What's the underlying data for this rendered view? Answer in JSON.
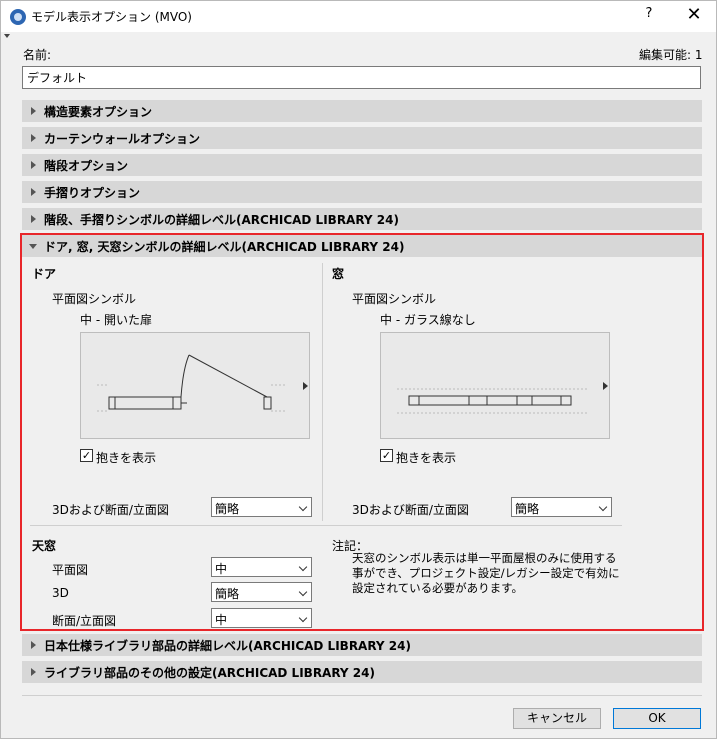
{
  "window": {
    "title": "モデル表示オプション (MVO)",
    "help": "?",
    "close": "✕"
  },
  "name_label": "名前:",
  "edit_label": "編集可能: 1",
  "name_value": "デフォルト",
  "sections_collapsed_top": [
    "構造要素オプション",
    "カーテンウォールオプション",
    "階段オプション",
    "手摺りオプション",
    "階段、手摺りシンボルの詳細レベル(ARCHICAD LIBRARY 24)"
  ],
  "expanded_section": {
    "title": "ドア, 窓, 天窓シンボルの詳細レベル(ARCHICAD LIBRARY 24)",
    "door": {
      "heading": "ドア",
      "plan_symbol_label": "平面図シンボル",
      "plan_symbol_value": "中 - 開いた扉",
      "show_swing_label": "抱きを表示",
      "show_swing_checked": true,
      "section_label": "3Dおよび断面/立面図",
      "section_value": "簡略"
    },
    "window": {
      "heading": "窓",
      "plan_symbol_label": "平面図シンボル",
      "plan_symbol_value": "中 - ガラス線なし",
      "show_swing_label": "抱きを表示",
      "show_swing_checked": true,
      "section_label": "3Dおよび断面/立面図",
      "section_value": "簡略"
    },
    "skylight": {
      "heading": "天窓",
      "plan_label": "平面図",
      "plan_value": "中",
      "three_d_label": "3D",
      "three_d_value": "簡略",
      "section_label": "断面/立面図",
      "section_value": "中"
    },
    "note": {
      "heading": "注記：",
      "text": "天窓のシンボル表示は単一平面屋根のみに使用する事ができ、プロジェクト設定/レガシー設定で有効に設定されている必要があります。"
    }
  },
  "sections_collapsed_bottom": [
    "日本仕様ライブラリ部品の詳細レベル(ARCHICAD LIBRARY 24)",
    "ライブラリ部品のその他の設定(ARCHICAD LIBRARY 24)"
  ],
  "buttons": {
    "cancel": "キャンセル",
    "ok": "OK"
  },
  "colors": {
    "highlight_border": "#e8262a",
    "section_bg": "#d7d7d7",
    "ok_border": "#0078d7"
  }
}
